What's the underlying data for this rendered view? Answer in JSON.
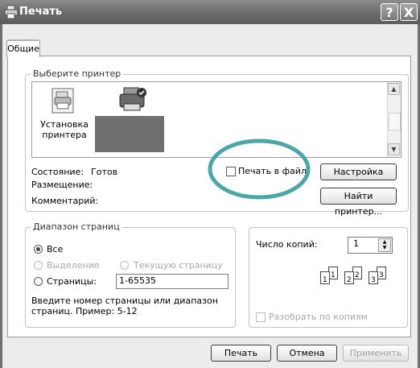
{
  "window": {
    "title": "Печать",
    "help_label": "?",
    "close_label": "X"
  },
  "tab": {
    "label": "Общие"
  },
  "printer_group": {
    "label": "Выберите принтер",
    "add_printer_label": [
      "Установка",
      "принтера"
    ],
    "status_label": "Состояние:",
    "status_value": "Готов",
    "location_label": "Размещение:",
    "comment_label": "Комментарий:",
    "print_to_file_label": "Печать в файл",
    "preferences_button": "Настройка",
    "find_printer_button": "Найти принтер..."
  },
  "range_group": {
    "label": "Диапазон страниц",
    "all_label": "Все",
    "selection_label": "Выделение",
    "current_page_label": "Текущую страницу",
    "pages_label": "Страницы:",
    "pages_value": "1-65535",
    "hint_line1": "Введите номер страницы или диапазон",
    "hint_line2": "страниц.  Пример: 5-12",
    "selected": "all"
  },
  "copies": {
    "label": "Число копий:",
    "value": "1",
    "collate_label": "Разобрать по копиям",
    "collate_checked": false
  },
  "footer": {
    "print_button": "Печать",
    "cancel_button": "Отмена",
    "apply_button": "Применить"
  }
}
